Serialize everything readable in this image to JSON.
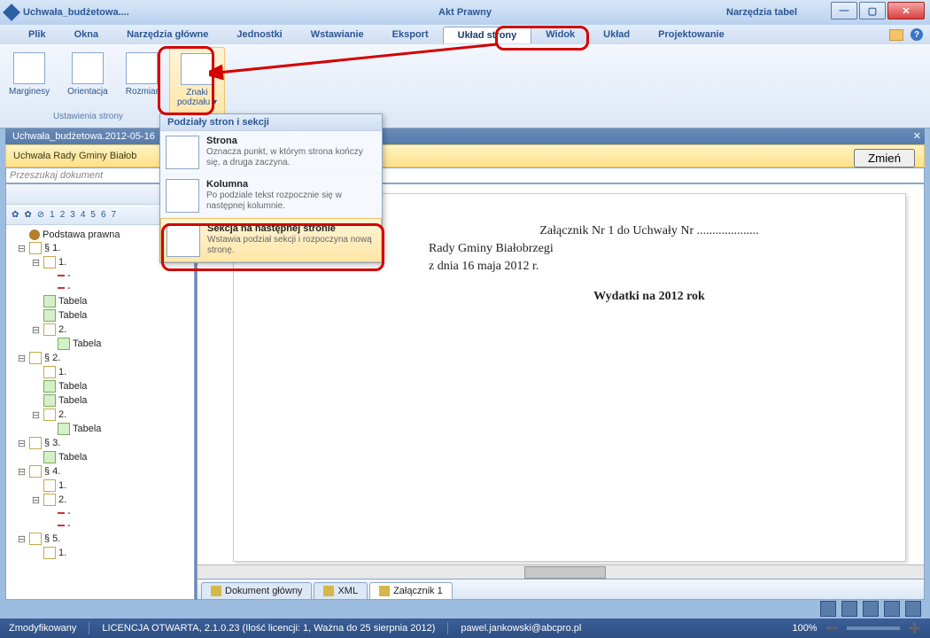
{
  "title": {
    "doc": "Uchwała_budżetowa....",
    "app": "Akt Prawny",
    "tools": "Narzędzia tabel"
  },
  "menu": {
    "items": [
      "Plik",
      "Okna",
      "Narzędzia główne",
      "Jednostki",
      "Wstawianie",
      "Eksport",
      "Układ strony",
      "Widok",
      "Układ",
      "Projektowanie"
    ],
    "active": 6
  },
  "ribbon": {
    "group": "Ustawienia strony",
    "btns": [
      {
        "l": "Marginesy"
      },
      {
        "l": "Orientacja"
      },
      {
        "l": "Rozmiar"
      },
      {
        "l": "Znaki\npodziału ▾"
      }
    ],
    "hl": 3
  },
  "popup": {
    "header": "Podziały stron i sekcji",
    "items": [
      {
        "t": "Strona",
        "d": "Oznacza punkt, w którym strona kończy się, a druga zaczyna."
      },
      {
        "t": "Kolumna",
        "d": "Po podziale tekst rozpocznie się w następnej kolumnie."
      },
      {
        "t": "Sekcja na następnej stronie",
        "d": "Wstawia podział sekcji i rozpoczyna nową stronę."
      }
    ],
    "hl": 2
  },
  "docbar": {
    "name": "Uchwała_budżetowa.2012-05-16",
    "subtitle": "Uchwała Rady Gminy Białob",
    "change": "Zmień"
  },
  "search": {
    "ph": "Przeszukaj dokument"
  },
  "treeToolbar": {
    "nums": [
      "1",
      "2",
      "3",
      "4",
      "5",
      "6",
      "7"
    ]
  },
  "tree": [
    {
      "d": 0,
      "tw": "",
      "ic": "root",
      "l": "Podstawa prawna"
    },
    {
      "d": 0,
      "tw": "⊟",
      "ic": "para",
      "l": "§ 1."
    },
    {
      "d": 1,
      "tw": "⊟",
      "ic": "para",
      "l": "1."
    },
    {
      "d": 2,
      "tw": "",
      "ic": "dash",
      "l": "-"
    },
    {
      "d": 2,
      "tw": "",
      "ic": "dash",
      "l": "-"
    },
    {
      "d": 1,
      "tw": "",
      "ic": "tbl",
      "l": "Tabela"
    },
    {
      "d": 1,
      "tw": "",
      "ic": "tbl",
      "l": "Tabela"
    },
    {
      "d": 1,
      "tw": "⊟",
      "ic": "para",
      "l": "2."
    },
    {
      "d": 2,
      "tw": "",
      "ic": "tbl",
      "l": "Tabela"
    },
    {
      "d": 0,
      "tw": "⊟",
      "ic": "para",
      "l": "§ 2."
    },
    {
      "d": 1,
      "tw": "",
      "ic": "para",
      "l": "1."
    },
    {
      "d": 1,
      "tw": "",
      "ic": "tbl",
      "l": "Tabela"
    },
    {
      "d": 1,
      "tw": "",
      "ic": "tbl",
      "l": "Tabela"
    },
    {
      "d": 1,
      "tw": "⊟",
      "ic": "para",
      "l": "2."
    },
    {
      "d": 2,
      "tw": "",
      "ic": "tbl",
      "l": "Tabela"
    },
    {
      "d": 0,
      "tw": "⊟",
      "ic": "para",
      "l": "§ 3."
    },
    {
      "d": 1,
      "tw": "",
      "ic": "tbl",
      "l": "Tabela"
    },
    {
      "d": 0,
      "tw": "⊟",
      "ic": "para",
      "l": "§ 4."
    },
    {
      "d": 1,
      "tw": "",
      "ic": "para",
      "l": "1."
    },
    {
      "d": 1,
      "tw": "⊟",
      "ic": "para",
      "l": "2."
    },
    {
      "d": 2,
      "tw": "",
      "ic": "dash",
      "l": "-"
    },
    {
      "d": 2,
      "tw": "",
      "ic": "dash",
      "l": "-"
    },
    {
      "d": 0,
      "tw": "⊟",
      "ic": "para",
      "l": "§ 5."
    },
    {
      "d": 1,
      "tw": "",
      "ic": "para",
      "l": "1."
    }
  ],
  "page": {
    "l1": "Załącznik Nr 1 do Uchwały Nr ....................",
    "l2": "Rady Gminy Białobrzegi",
    "l3": "z dnia 16 maja 2012 r.",
    "l4": "Wydatki na 2012 rok"
  },
  "tabs": [
    {
      "l": "Dokument główny",
      "ic": "doc"
    },
    {
      "l": "XML",
      "ic": "xml"
    },
    {
      "l": "Załącznik 1",
      "ic": "att"
    }
  ],
  "activeTab": 2,
  "status": {
    "mod": "Zmodyfikowany",
    "lic": "LICENCJA OTWARTA, 2.1.0.23 (Ilość licencji: 1, Ważna do 25 sierpnia 2012)",
    "user": "pawel.jankowski@abcpro.pl",
    "zoom": "100%"
  }
}
